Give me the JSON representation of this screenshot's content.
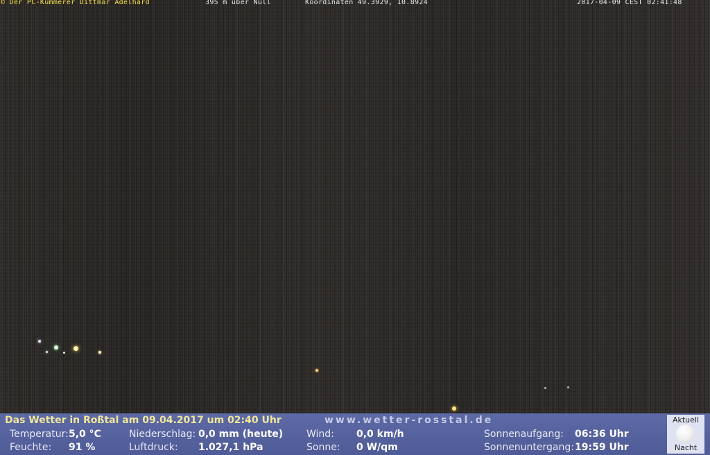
{
  "overlay": {
    "copyright": "© Der PC-Kümmerer Dittmar Adelhard",
    "altitude": "395 m über Null",
    "coordinates": "Koordinaten 49.3929, 10.8924",
    "timestamp": "2017-04-09 CEST 02:41:48"
  },
  "weather": {
    "title": "Das Wetter in Roßtal am 09.04.2017 um 02:40 Uhr",
    "site": "www.wetter-rosstal.de",
    "temperature_label": "Temperatur:",
    "temperature_value": "5,0 °C",
    "humidity_label": "Feuchte:",
    "humidity_value": "91 %",
    "precip_label": "Niederschlag:",
    "precip_value": "0,0 mm (heute)",
    "pressure_label": "Luftdruck:",
    "pressure_value": "1.027,1 hPa",
    "wind_label": "Wind:",
    "wind_value": "0,0 km/h",
    "sun_label": "Sonne:",
    "sun_value": "0 W/qm",
    "sunrise_label": "Sonnenaufgang:",
    "sunrise_value": "06:36 Uhr",
    "sunset_label": "Sonnenuntergang:",
    "sunset_value": "19:59 Uhr"
  },
  "moon": {
    "top_label": "Aktuell",
    "bottom_label": "Nacht",
    "icon": "full-moon-icon"
  },
  "colors": {
    "overlay_accent": "#f4e04a",
    "bar_background": "#5d6aa6",
    "title_color": "#f1e79a"
  }
}
